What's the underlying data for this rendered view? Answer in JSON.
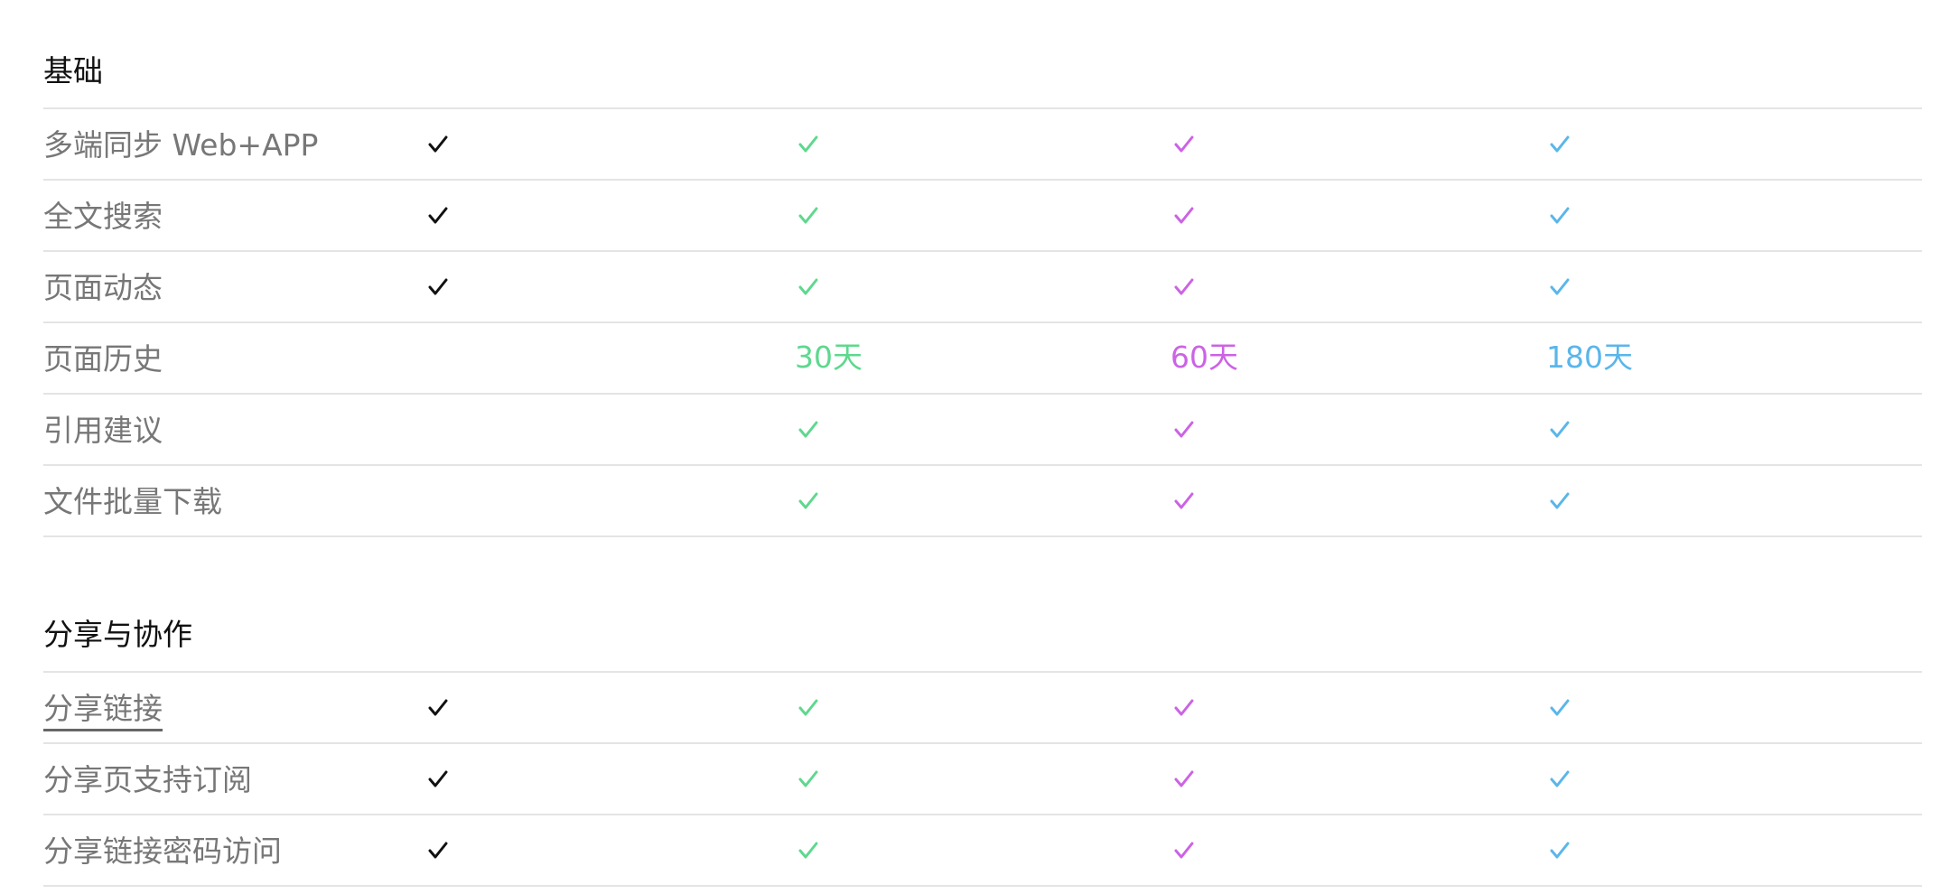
{
  "colors": {
    "free": "#111111",
    "green": "#5ed88e",
    "purple": "#cc63e4",
    "blue": "#5ab6ea"
  },
  "icons": {
    "check": "check-icon"
  },
  "sections": [
    {
      "title": "基础",
      "rows": [
        {
          "feature": "多端同步 Web+APP",
          "cells": [
            "check",
            "check",
            "check",
            "check"
          ]
        },
        {
          "feature": "全文搜索",
          "cells": [
            "check",
            "check",
            "check",
            "check"
          ]
        },
        {
          "feature": "页面动态",
          "cells": [
            "check",
            "check",
            "check",
            "check"
          ]
        },
        {
          "feature": "页面历史",
          "cells": [
            "",
            "30天",
            "60天",
            "180天"
          ]
        },
        {
          "feature": "引用建议",
          "cells": [
            "",
            "check",
            "check",
            "check"
          ]
        },
        {
          "feature": "文件批量下载",
          "cells": [
            "",
            "check",
            "check",
            "check"
          ]
        }
      ]
    },
    {
      "title": "分享与协作",
      "rows": [
        {
          "feature": "分享链接",
          "cells": [
            "check",
            "check",
            "check",
            "check"
          ],
          "link": true
        },
        {
          "feature": "分享页支持订阅",
          "cells": [
            "check",
            "check",
            "check",
            "check"
          ]
        },
        {
          "feature": "分享链接密码访问",
          "cells": [
            "check",
            "check",
            "check",
            "check"
          ]
        }
      ]
    }
  ]
}
